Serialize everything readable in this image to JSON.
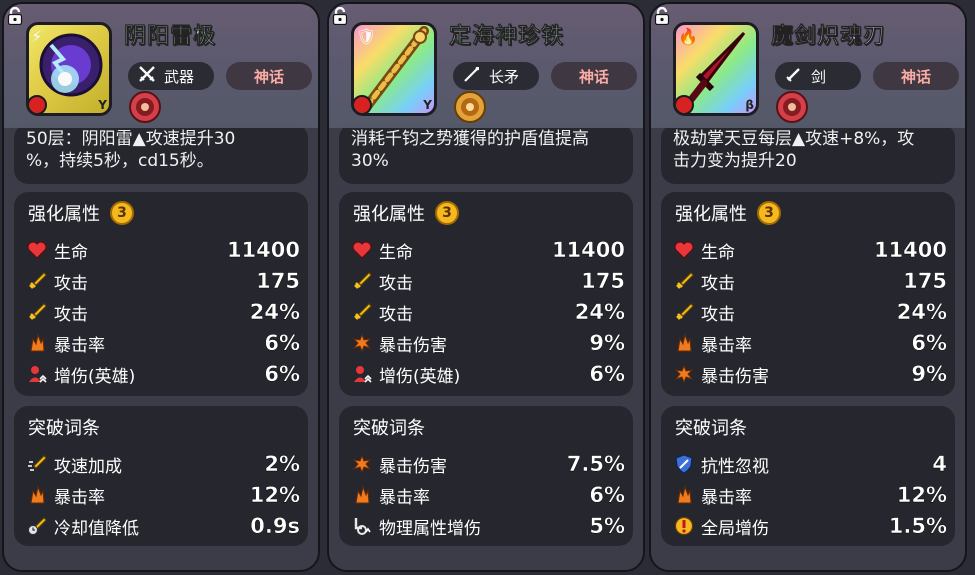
{
  "cards": [
    {
      "name": "阴阳雷极",
      "type_label": "武器",
      "rarity": "神话",
      "portrait_letter": "Y",
      "description": [
        "50层：阴阳雷▲攻速提升30",
        "%，持续5秒，cd15秒。"
      ],
      "enhance_title": "强化属性",
      "enhance_level": "3",
      "enhance_stats": [
        {
          "icon": "heart-icon",
          "label": "生命",
          "value": "11400"
        },
        {
          "icon": "sword-icon",
          "label": "攻击",
          "value": "175"
        },
        {
          "icon": "sword-icon",
          "label": "攻击",
          "value": "24%"
        },
        {
          "icon": "crit-icon",
          "label": "暴击率",
          "value": "6%"
        },
        {
          "icon": "hero-damage-icon",
          "label": "增伤(英雄)",
          "value": "6%"
        }
      ],
      "breakthrough_title": "突破词条",
      "breakthrough_stats": [
        {
          "icon": "attack-speed-icon",
          "label": "攻速加成",
          "value": "2%"
        },
        {
          "icon": "crit-icon",
          "label": "暴击率",
          "value": "12%"
        },
        {
          "icon": "cooldown-icon",
          "label": "冷却值降低",
          "value": "0.9s"
        }
      ]
    },
    {
      "name": "定海神珍铁",
      "type_label": "长矛",
      "rarity": "神话",
      "portrait_letter": "Y",
      "description": [
        "消耗千钧之势獲得的护盾值提高",
        "30%"
      ],
      "enhance_title": "强化属性",
      "enhance_level": "3",
      "enhance_stats": [
        {
          "icon": "heart-icon",
          "label": "生命",
          "value": "11400"
        },
        {
          "icon": "sword-icon",
          "label": "攻击",
          "value": "175"
        },
        {
          "icon": "sword-icon",
          "label": "攻击",
          "value": "24%"
        },
        {
          "icon": "crit-damage-icon",
          "label": "暴击伤害",
          "value": "9%"
        },
        {
          "icon": "hero-damage-icon",
          "label": "增伤(英雄)",
          "value": "6%"
        }
      ],
      "breakthrough_title": "突破词条",
      "breakthrough_stats": [
        {
          "icon": "crit-damage-icon",
          "label": "暴击伤害",
          "value": "7.5%"
        },
        {
          "icon": "crit-icon",
          "label": "暴击率",
          "value": "6%"
        },
        {
          "icon": "physical-damage-icon",
          "label": "物理属性增伤",
          "value": "5%"
        }
      ]
    },
    {
      "name": "魔剑炽魂刃",
      "type_label": "剑",
      "rarity": "神话",
      "portrait_letter": "β",
      "description": [
        "极劫掌天豆每层▲攻速+8%，攻",
        "击力变为提升20"
      ],
      "enhance_title": "强化属性",
      "enhance_level": "3",
      "enhance_stats": [
        {
          "icon": "heart-icon",
          "label": "生命",
          "value": "11400"
        },
        {
          "icon": "sword-icon",
          "label": "攻击",
          "value": "175"
        },
        {
          "icon": "sword-icon",
          "label": "攻击",
          "value": "24%"
        },
        {
          "icon": "crit-icon",
          "label": "暴击率",
          "value": "6%"
        },
        {
          "icon": "crit-damage-icon",
          "label": "暴击伤害",
          "value": "9%"
        }
      ],
      "breakthrough_title": "突破词条",
      "breakthrough_stats": [
        {
          "icon": "shield-ignore-icon",
          "label": "抗性忽视",
          "value": "4"
        },
        {
          "icon": "crit-icon",
          "label": "暴击率",
          "value": "12%"
        },
        {
          "icon": "global-damage-icon",
          "label": "全局增伤",
          "value": "1.5%"
        }
      ]
    }
  ],
  "colors": {
    "card_bg": "#3b3c48",
    "panel_bg": "#26272e",
    "rarity_text": "#ffb0a8",
    "coin": "#f5b820",
    "heart": "#e8363a",
    "sword": "#f5c21a",
    "crit": "#f07a1e"
  }
}
